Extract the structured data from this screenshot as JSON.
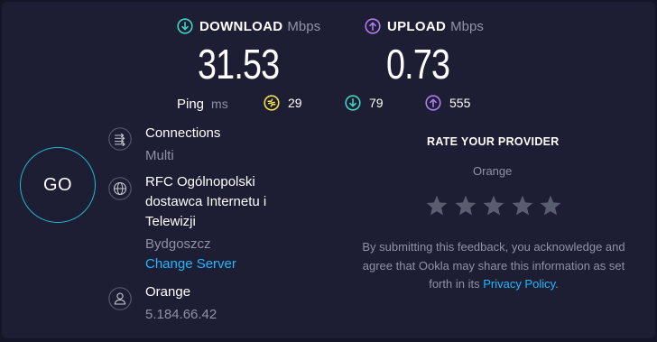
{
  "download": {
    "title": "DOWNLOAD",
    "unit": "Mbps",
    "value": "31.53"
  },
  "upload": {
    "title": "UPLOAD",
    "unit": "Mbps",
    "value": "0.73"
  },
  "ping": {
    "label": "Ping",
    "unit": "ms",
    "idle": "29",
    "download": "79",
    "upload": "555"
  },
  "go_label": "GO",
  "connections": {
    "title": "Connections",
    "value": "Multi"
  },
  "server": {
    "name_line1": "RFC Ogólnopolski",
    "name_line2": "dostawca Internetu i",
    "name_line3": "Telewizji",
    "city": "Bydgoszcz",
    "change_label": "Change Server"
  },
  "isp": {
    "name": "Orange",
    "ip": "5.184.66.42"
  },
  "rating": {
    "title": "RATE YOUR PROVIDER",
    "provider": "Orange",
    "stars": 5,
    "rating_value": 0,
    "feedback_line1": "By submitting this feedback, you acknowledge and",
    "feedback_line2": "agree that Ookla may share this information as set",
    "feedback_line3_prefix": "forth in its",
    "privacy_label": "Privacy Policy",
    "feedback_suffix": "."
  },
  "colors": {
    "background": "#1d1e33",
    "download_accent": "#3fd6c6",
    "upload_accent": "#b07cf0",
    "idle_accent": "#f2e14c",
    "go_ring": "#1fb8cd",
    "link": "#1fb8ff",
    "star": "#5a5c70"
  },
  "icons": {
    "download": "arrow-down-circle-icon",
    "upload": "arrow-up-circle-icon",
    "idle": "lightning-circle-icon",
    "connections": "connections-arrows-icon",
    "server": "globe-icon",
    "isp": "user-icon",
    "star": "star-icon"
  }
}
